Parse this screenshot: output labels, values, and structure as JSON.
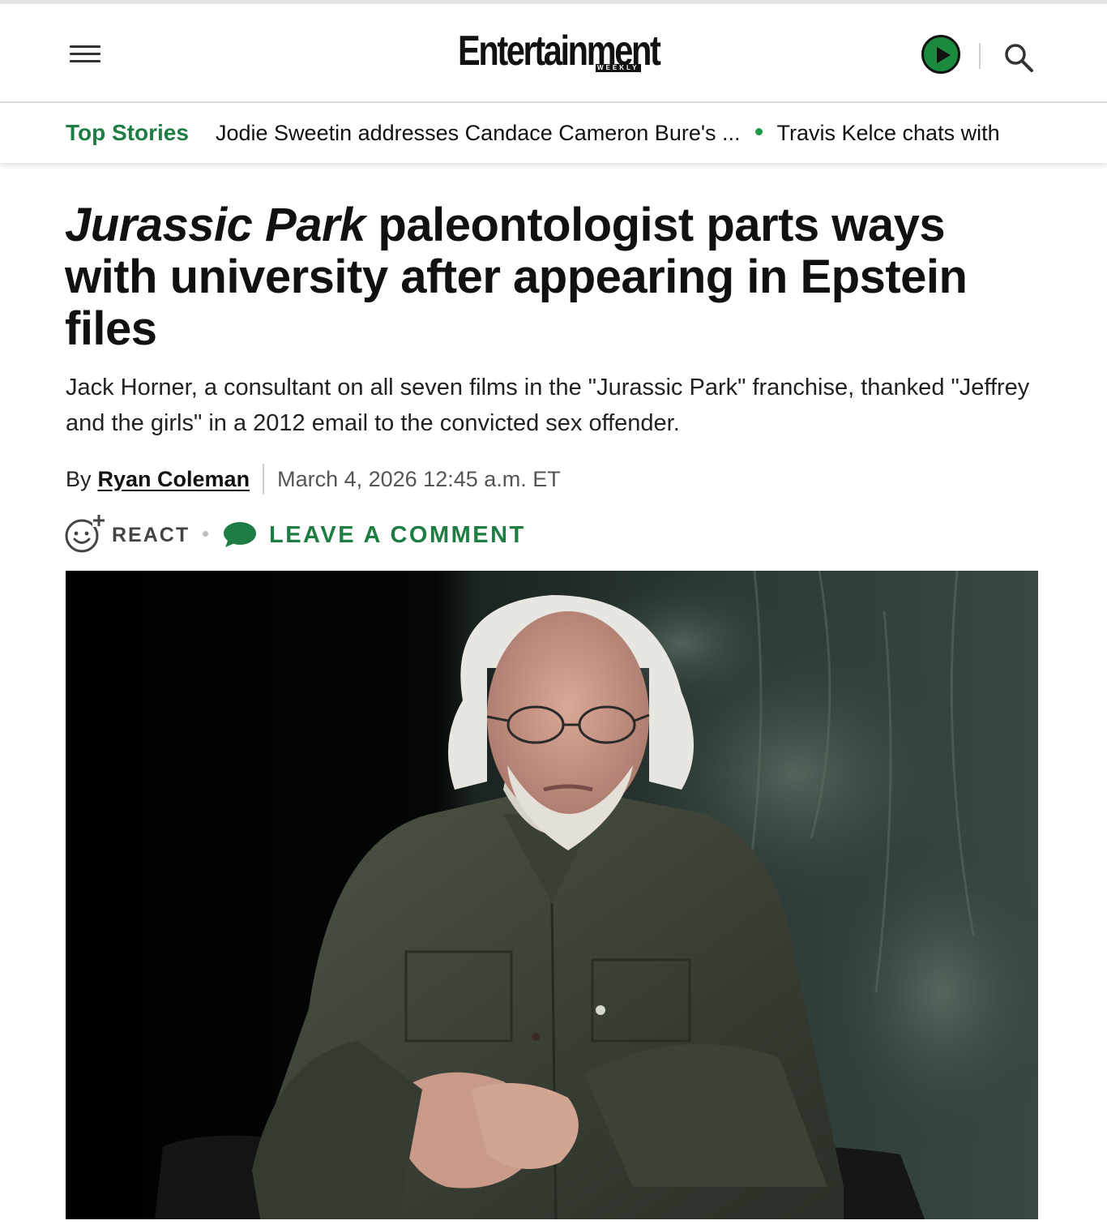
{
  "header": {
    "logo_text": "Entertainment",
    "logo_subtext": "WEEKLY",
    "menu_icon": "hamburger-menu-icon",
    "play_icon": "play-icon",
    "search_icon": "search-icon"
  },
  "top_stories": {
    "label": "Top Stories",
    "items": [
      "Jodie Sweetin addresses Candace Cameron Bure's ...",
      "Travis Kelce chats with"
    ]
  },
  "article": {
    "headline_italic": "Jurassic Park",
    "headline_rest": " paleontologist parts ways with university after appearing in Epstein files",
    "dek": "Jack Horner, a consultant on all seven films in the \"Jurassic Park\" franchise, thanked \"Jeffrey and the girls\" in a 2012 email to the convicted sex offender.",
    "byline_prefix": "By",
    "author": "Ryan Coleman",
    "date": "March 4, 2026 12:45 a.m. ET"
  },
  "social": {
    "react_label": "REACT",
    "comment_label": "LEAVE A COMMENT"
  },
  "colors": {
    "brand_green": "#1e7d43",
    "play_green": "#1b8a3f",
    "text": "#111111"
  }
}
